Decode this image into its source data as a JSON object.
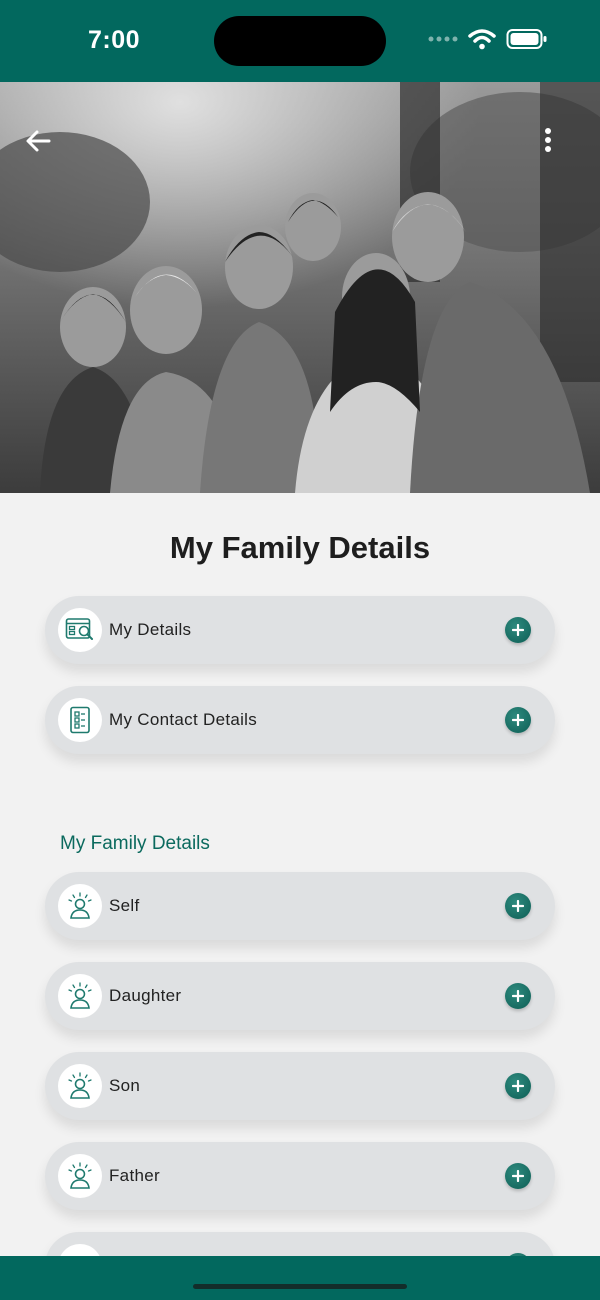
{
  "status_bar": {
    "time": "7:00"
  },
  "hero": {
    "image_description_icon": "family-photo"
  },
  "header": {
    "back_icon": "back-arrow-icon",
    "menu_icon": "more-vertical-icon"
  },
  "page": {
    "title": "My Family Details"
  },
  "top_cards": [
    {
      "label": "My Details",
      "icon": "details-search-icon"
    },
    {
      "label": "My Contact Details",
      "icon": "contact-list-icon"
    }
  ],
  "family_section": {
    "heading": "My Family Details",
    "members": [
      {
        "label": "Self",
        "icon": "person-icon"
      },
      {
        "label": "Daughter",
        "icon": "person-icon"
      },
      {
        "label": "Son",
        "icon": "person-icon"
      },
      {
        "label": "Father",
        "icon": "person-icon"
      },
      {
        "label": "",
        "icon": "person-icon"
      }
    ]
  },
  "colors": {
    "brand": "#02685e",
    "accent": "#0b6a5e",
    "card_bg": "#dfe1e3",
    "page_bg": "#f2f2f2"
  }
}
